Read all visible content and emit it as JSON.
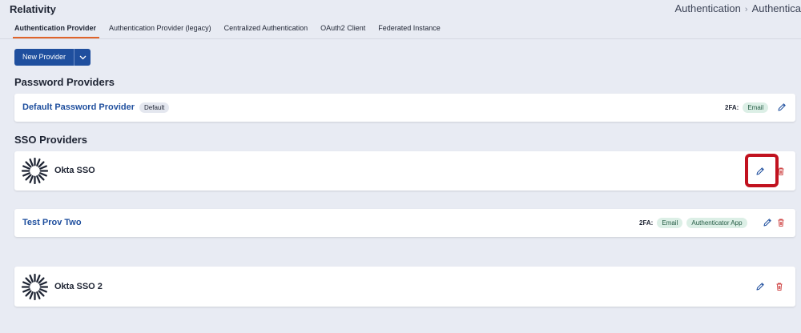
{
  "app": {
    "title": "Relativity"
  },
  "breadcrumb": {
    "items": [
      "Authentication",
      "Authentica"
    ]
  },
  "tabs": [
    {
      "label": "Authentication Provider",
      "active": true
    },
    {
      "label": "Authentication Provider (legacy)",
      "active": false
    },
    {
      "label": "Centralized Authentication",
      "active": false
    },
    {
      "label": "OAuth2 Client",
      "active": false
    },
    {
      "label": "Federated Instance",
      "active": false
    }
  ],
  "toolbar": {
    "new_provider_label": "New Provider"
  },
  "password_section": {
    "title": "Password Providers",
    "providers": [
      {
        "name": "Default Password Provider",
        "badge": "Default",
        "twofa_label": "2FA:",
        "twofa_methods": [
          "Email"
        ]
      }
    ]
  },
  "sso_section": {
    "title": "SSO Providers",
    "providers": [
      {
        "name": "Okta SSO",
        "logo": "okta-sunburst-icon"
      },
      {
        "name": "Test Prov Two",
        "twofa_label": "2FA:",
        "twofa_methods": [
          "Email",
          "Authenticator App"
        ]
      },
      {
        "name": "Okta SSO 2",
        "logo": "okta-sunburst-icon"
      }
    ]
  },
  "colors": {
    "accent": "#1f4f9e",
    "tab_underline": "#e0632a",
    "delete": "#d04a4a",
    "highlight": "#c1121f",
    "pill_bg": "#dcefe6"
  }
}
